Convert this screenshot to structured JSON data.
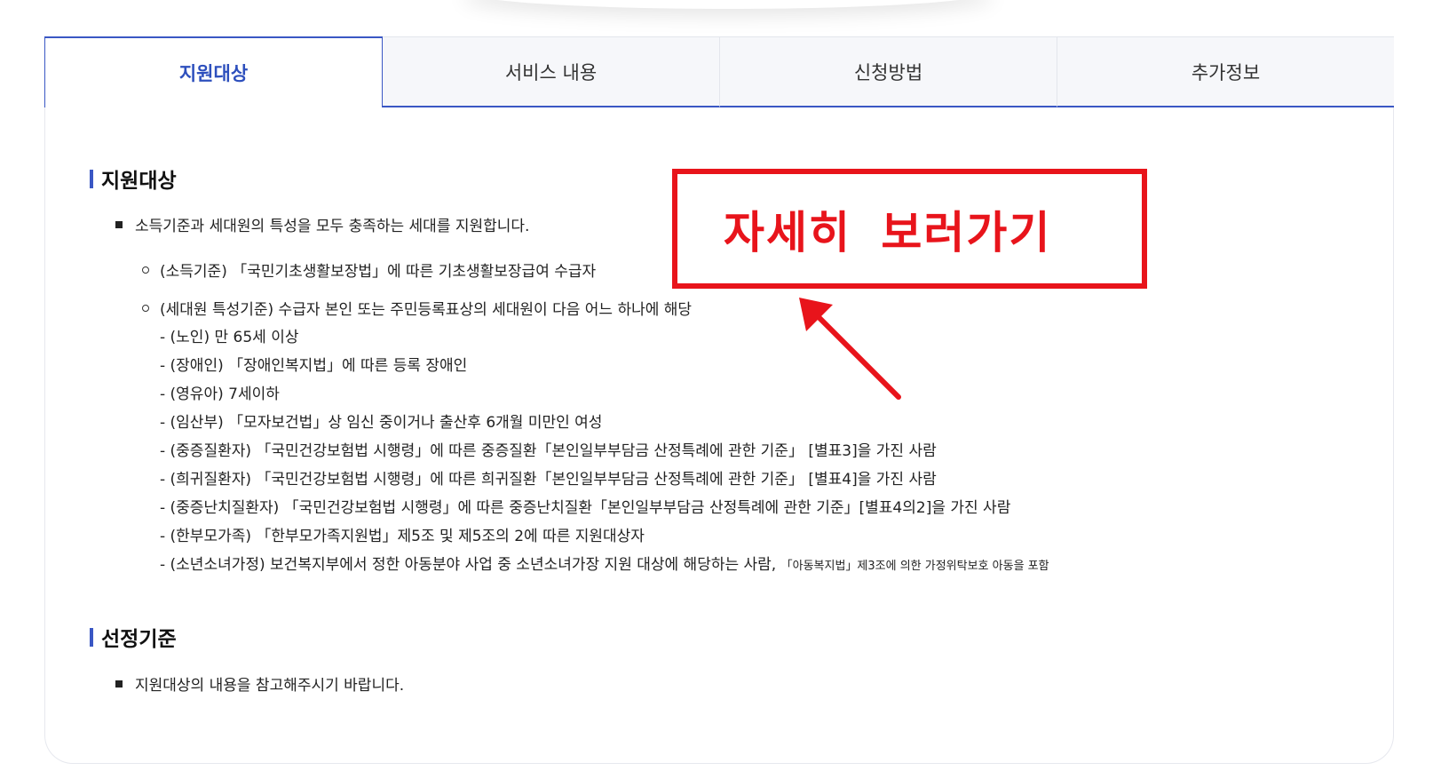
{
  "tabs": [
    {
      "label": "지원대상",
      "active": true
    },
    {
      "label": "서비스 내용",
      "active": false
    },
    {
      "label": "신청방법",
      "active": false
    },
    {
      "label": "추가정보",
      "active": false
    }
  ],
  "section1": {
    "title": "지원대상",
    "bullet": "소득기준과 세대원의 특성을 모두 충족하는 세대를 지원합니다.",
    "criteria": [
      "(소득기준) 「국민기초생활보장법」에 따른 기초생활보장급여 수급자",
      "(세대원 특성기준) 수급자 본인 또는 주민등록표상의 세대원이 다음 어느 하나에 해당"
    ],
    "sub_items": [
      "- (노인) 만 65세 이상",
      "- (장애인) 「장애인복지법」에 따른 등록 장애인",
      "- (영유아) 7세이하",
      "- (임산부) 「모자보건법」상 임신 중이거나 출산후 6개월 미만인 여성",
      "- (중증질환자) 「국민건강보험법 시행령」에 따른 중증질환「본인일부부담금 산정특례에 관한 기준」 [별표3]을 가진 사람",
      "- (희귀질환자) 「국민건강보험법 시행령」에 따른 희귀질환「본인일부부담금 산정특례에 관한 기준」 [별표4]을 가진 사람",
      "- (중증난치질환자) 「국민건강보험법 시행령」에 따른 중증난치질환「본인일부부담금 산정특례에 관한 기준」[별표4의2]을 가진 사람",
      "- (한부모가족) 「한부모가족지원법」제5조 및 제5조의 2에 따른 지원대상자"
    ],
    "last_item": "- (소년소녀가정) 보건복지부에서 정한 아동분야 사업 중 소년소녀가장 지원 대상에 해당하는 사람,",
    "last_item_note": "「아동복지법」제3조에 의한 가정위탁보호 아동을 포함"
  },
  "section2": {
    "title": "선정기준",
    "bullet": "지원대상의 내용을 참고해주시기 바랍니다."
  },
  "callout": {
    "label": "자세히 보러가기",
    "color": "#e8141b"
  },
  "colors": {
    "accent": "#3a57c4",
    "active_tab_text": "#2d4fbd"
  }
}
